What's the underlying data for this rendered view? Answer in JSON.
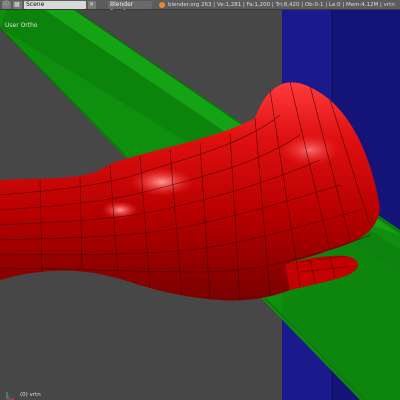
{
  "header": {
    "scene_value": "Scene",
    "render_engine": "Blender Render",
    "info_text": "blender.org 263 | Ve:1,281 | Fa:1,200 | Tri:8,420 | Ob:0-1 | La:0 | Mem:4.12M | vrtn"
  },
  "viewport": {
    "view_label": "User Ortho",
    "object_label": "(0) vrtn",
    "colors": {
      "background": "#474747",
      "mesh": "#d40000",
      "green_band": "#0e8f0e",
      "blue_plane": "#1a1a8c"
    }
  }
}
